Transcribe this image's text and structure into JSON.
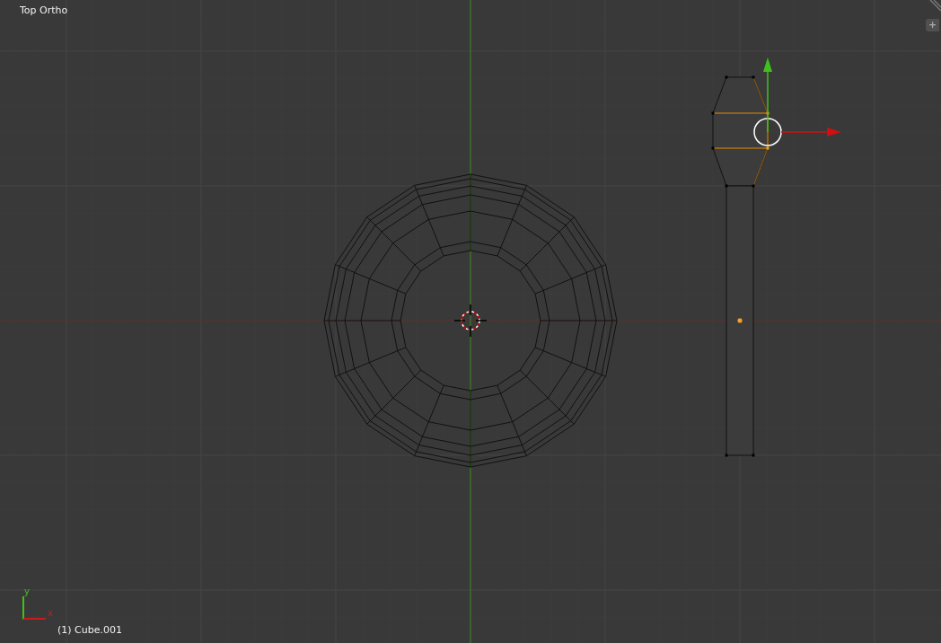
{
  "viewport": {
    "view_label": "Top Ortho",
    "add_button": "+",
    "axis_y_label": "y",
    "axis_x_label": "x",
    "object_label": "(1) Cube.001"
  }
}
